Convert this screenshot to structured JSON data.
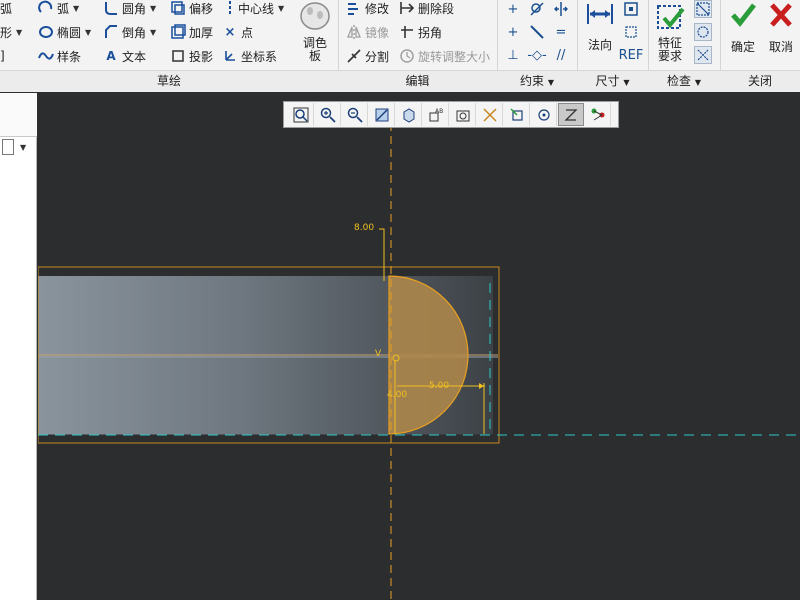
{
  "ribbon": {
    "sketch": {
      "row1": [
        {
          "label": "弧",
          "icon": "arc-icon"
        },
        {
          "label": "圆角",
          "icon": "fillet-icon"
        },
        {
          "label": "偏移",
          "icon": "offset-icon"
        },
        {
          "label": "中心线",
          "icon": "centerline-icon"
        }
      ],
      "row2": [
        {
          "label": "形",
          "icon": "rectangle-icon"
        },
        {
          "label": "椭圆",
          "icon": "ellipse-icon"
        },
        {
          "label": "倒角",
          "icon": "chamfer-icon"
        },
        {
          "label": "加厚",
          "icon": "thicken-icon"
        },
        {
          "label": "点",
          "icon": "point-icon"
        }
      ],
      "row3": [
        {
          "label": "样条",
          "icon": "spline-icon"
        },
        {
          "label": "文本",
          "icon": "text-icon"
        },
        {
          "label": "投影",
          "icon": "project-icon"
        },
        {
          "label": "坐标系",
          "icon": "coordinate-system-icon"
        }
      ],
      "palette_label": "调色板",
      "group_label": "草绘"
    },
    "edit": {
      "items": [
        {
          "label": "修改",
          "icon": "modify-icon",
          "disabled": false
        },
        {
          "label": "删除段",
          "icon": "delete-segment-icon",
          "disabled": false
        },
        {
          "label": "镜像",
          "icon": "mirror-icon",
          "disabled": true
        },
        {
          "label": "拐角",
          "icon": "corner-icon",
          "disabled": false
        },
        {
          "label": "分割",
          "icon": "divide-icon",
          "disabled": false
        },
        {
          "label": "旋转调整大小",
          "icon": "rotate-resize-icon",
          "disabled": true
        }
      ],
      "group_label": "编辑"
    },
    "constraint": {
      "group_label": "约束"
    },
    "dimension": {
      "normal_label": "法向",
      "group_label": "尺寸"
    },
    "inspect": {
      "feature_req_label": "特征要求",
      "group_label": "检查"
    },
    "close": {
      "ok_label": "确定",
      "cancel_label": "取消",
      "group_label": "关闭"
    }
  },
  "sketch": {
    "dims": {
      "top": "8.00",
      "radius": "4.00",
      "width": "5.00",
      "origin": "V"
    }
  },
  "colors": {
    "canvas_bg": "#2b2d2f",
    "sketch_orange": "#e8a020",
    "dim_yellow": "#f0c020",
    "cyan_dash": "#2ec8c8",
    "ok_green": "#2a9d3a",
    "cancel_red": "#c81e1e"
  }
}
